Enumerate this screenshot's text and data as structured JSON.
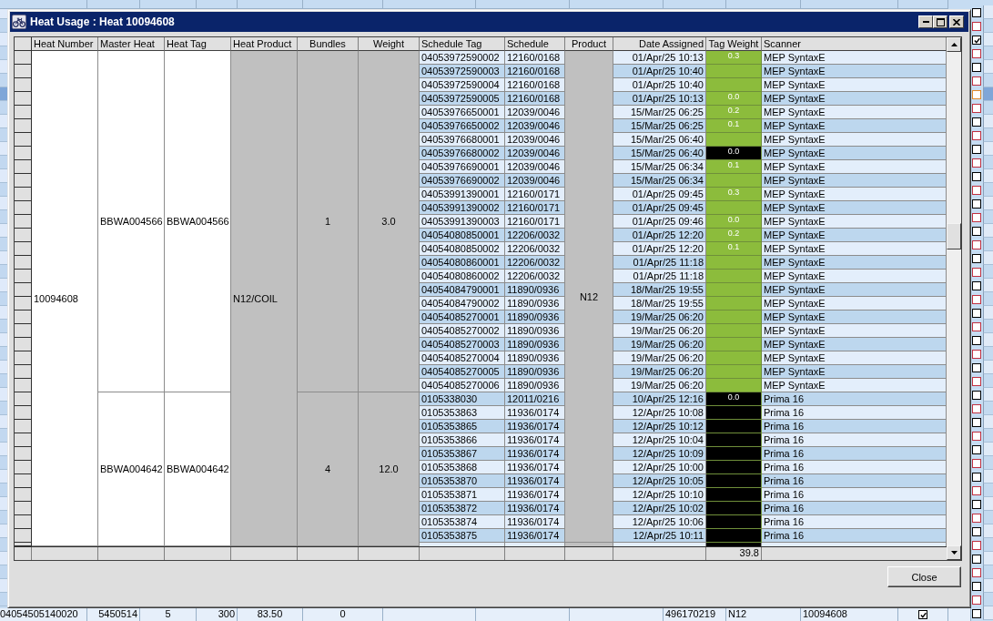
{
  "window": {
    "title": "Heat Usage : Heat 10094608"
  },
  "table": {
    "columns": [
      "Heat Number",
      "Master Heat",
      "Heat Tag",
      "Heat Product",
      "Bundles",
      "Weight",
      "Schedule Tag",
      "Schedule",
      "Product",
      "Date Assigned",
      "Tag Weight",
      "Scanner"
    ],
    "heat_number": "10094608",
    "heat_product": "N12/COIL",
    "product": "N12",
    "groups": [
      {
        "master_heat": "BBWA004566",
        "heat_tag": "BBWA004566",
        "bundles": "1",
        "weight": "3.0",
        "rows": [
          {
            "schedule_tag": "04053972590002",
            "schedule": "12160/0168",
            "date_assigned": "01/Apr/25 10:13",
            "tag_weight": "0.3",
            "color": "#8cbc3c",
            "scanner": "MEP SyntaxE"
          },
          {
            "schedule_tag": "04053972590003",
            "schedule": "12160/0168",
            "date_assigned": "01/Apr/25 10:40",
            "color": "#8cbc3c",
            "scanner": "MEP SyntaxE"
          },
          {
            "schedule_tag": "04053972590004",
            "schedule": "12160/0168",
            "date_assigned": "01/Apr/25 10:40",
            "color": "#8cbc3c",
            "scanner": "MEP SyntaxE"
          },
          {
            "schedule_tag": "04053972590005",
            "schedule": "12160/0168",
            "date_assigned": "01/Apr/25 10:13",
            "tag_weight": "0.0",
            "color": "#8cbc3c",
            "scanner": "MEP SyntaxE"
          },
          {
            "schedule_tag": "04053976650001",
            "schedule": "12039/0046",
            "date_assigned": "15/Mar/25 06:25",
            "tag_weight": "0.2",
            "color": "#8cbc3c",
            "scanner": "MEP SyntaxE"
          },
          {
            "schedule_tag": "04053976650002",
            "schedule": "12039/0046",
            "date_assigned": "15/Mar/25 06:25",
            "tag_weight": "0.1",
            "color": "#8cbc3c",
            "scanner": "MEP SyntaxE"
          },
          {
            "schedule_tag": "04053976680001",
            "schedule": "12039/0046",
            "date_assigned": "15/Mar/25 06:40",
            "color": "#8cbc3c",
            "scanner": "MEP SyntaxE"
          },
          {
            "schedule_tag": "04053976680002",
            "schedule": "12039/0046",
            "date_assigned": "15/Mar/25 06:40",
            "tag_weight": "0.0",
            "color": "#000000",
            "scanner": "MEP SyntaxE"
          },
          {
            "schedule_tag": "04053976690001",
            "schedule": "12039/0046",
            "date_assigned": "15/Mar/25 06:34",
            "tag_weight": "0.1",
            "color": "#8cbc3c",
            "scanner": "MEP SyntaxE"
          },
          {
            "schedule_tag": "04053976690002",
            "schedule": "12039/0046",
            "date_assigned": "15/Mar/25 06:34",
            "color": "#8cbc3c",
            "scanner": "MEP SyntaxE"
          },
          {
            "schedule_tag": "04053991390001",
            "schedule": "12160/0171",
            "date_assigned": "01/Apr/25 09:45",
            "tag_weight": "0.3",
            "color": "#8cbc3c",
            "scanner": "MEP SyntaxE"
          },
          {
            "schedule_tag": "04053991390002",
            "schedule": "12160/0171",
            "date_assigned": "01/Apr/25 09:45",
            "color": "#8cbc3c",
            "scanner": "MEP SyntaxE"
          },
          {
            "schedule_tag": "04053991390003",
            "schedule": "12160/0171",
            "date_assigned": "01/Apr/25 09:46",
            "tag_weight": "0.0",
            "color": "#8cbc3c",
            "scanner": "MEP SyntaxE"
          },
          {
            "schedule_tag": "04054080850001",
            "schedule": "12206/0032",
            "date_assigned": "01/Apr/25 12:20",
            "tag_weight": "0.2",
            "color": "#8cbc3c",
            "scanner": "MEP SyntaxE"
          },
          {
            "schedule_tag": "04054080850002",
            "schedule": "12206/0032",
            "date_assigned": "01/Apr/25 12:20",
            "tag_weight": "0.1",
            "color": "#8cbc3c",
            "scanner": "MEP SyntaxE"
          },
          {
            "schedule_tag": "04054080860001",
            "schedule": "12206/0032",
            "date_assigned": "01/Apr/25 11:18",
            "color": "#8cbc3c",
            "scanner": "MEP SyntaxE"
          },
          {
            "schedule_tag": "04054080860002",
            "schedule": "12206/0032",
            "date_assigned": "01/Apr/25 11:18",
            "color": "#8cbc3c",
            "scanner": "MEP SyntaxE"
          },
          {
            "schedule_tag": "04054084790001",
            "schedule": "11890/0936",
            "date_assigned": "18/Mar/25 19:55",
            "color": "#8cbc3c",
            "scanner": "MEP SyntaxE"
          },
          {
            "schedule_tag": "04054084790002",
            "schedule": "11890/0936",
            "date_assigned": "18/Mar/25 19:55",
            "color": "#8cbc3c",
            "scanner": "MEP SyntaxE"
          },
          {
            "schedule_tag": "04054085270001",
            "schedule": "11890/0936",
            "date_assigned": "19/Mar/25 06:20",
            "color": "#8cbc3c",
            "scanner": "MEP SyntaxE"
          },
          {
            "schedule_tag": "04054085270002",
            "schedule": "11890/0936",
            "date_assigned": "19/Mar/25 06:20",
            "color": "#8cbc3c",
            "scanner": "MEP SyntaxE"
          },
          {
            "schedule_tag": "04054085270003",
            "schedule": "11890/0936",
            "date_assigned": "19/Mar/25 06:20",
            "color": "#8cbc3c",
            "scanner": "MEP SyntaxE"
          },
          {
            "schedule_tag": "04054085270004",
            "schedule": "11890/0936",
            "date_assigned": "19/Mar/25 06:20",
            "color": "#8cbc3c",
            "scanner": "MEP SyntaxE"
          },
          {
            "schedule_tag": "04054085270005",
            "schedule": "11890/0936",
            "date_assigned": "19/Mar/25 06:20",
            "color": "#8cbc3c",
            "scanner": "MEP SyntaxE"
          },
          {
            "schedule_tag": "04054085270006",
            "schedule": "11890/0936",
            "date_assigned": "19/Mar/25 06:20",
            "color": "#8cbc3c",
            "scanner": "MEP SyntaxE"
          }
        ]
      },
      {
        "master_heat": "BBWA004642",
        "heat_tag": "BBWA004642",
        "bundles": "4",
        "weight": "12.0",
        "rows": [
          {
            "schedule_tag": "0105338030",
            "schedule": "12011/0216",
            "date_assigned": "10/Apr/25 12:16",
            "tag_weight": "0.0",
            "color": "#000000",
            "scanner": "Prima 16"
          },
          {
            "schedule_tag": "0105353863",
            "schedule": "11936/0174",
            "date_assigned": "12/Apr/25 10:08",
            "color": "#000000",
            "scanner": "Prima 16"
          },
          {
            "schedule_tag": "0105353865",
            "schedule": "11936/0174",
            "date_assigned": "12/Apr/25 10:12",
            "color": "#000000",
            "scanner": "Prima 16"
          },
          {
            "schedule_tag": "0105353866",
            "schedule": "11936/0174",
            "date_assigned": "12/Apr/25 10:04",
            "color": "#000000",
            "scanner": "Prima 16"
          },
          {
            "schedule_tag": "0105353867",
            "schedule": "11936/0174",
            "date_assigned": "12/Apr/25 10:09",
            "color": "#000000",
            "scanner": "Prima 16"
          },
          {
            "schedule_tag": "0105353868",
            "schedule": "11936/0174",
            "date_assigned": "12/Apr/25 10:00",
            "color": "#000000",
            "scanner": "Prima 16"
          },
          {
            "schedule_tag": "0105353870",
            "schedule": "11936/0174",
            "date_assigned": "12/Apr/25 10:05",
            "color": "#000000",
            "scanner": "Prima 16"
          },
          {
            "schedule_tag": "0105353871",
            "schedule": "11936/0174",
            "date_assigned": "12/Apr/25 10:10",
            "color": "#000000",
            "scanner": "Prima 16"
          },
          {
            "schedule_tag": "0105353872",
            "schedule": "11936/0174",
            "date_assigned": "12/Apr/25 10:02",
            "color": "#000000",
            "scanner": "Prima 16"
          },
          {
            "schedule_tag": "0105353874",
            "schedule": "11936/0174",
            "date_assigned": "12/Apr/25 10:06",
            "color": "#000000",
            "scanner": "Prima 16"
          },
          {
            "schedule_tag": "0105353875",
            "schedule": "11936/0174",
            "date_assigned": "12/Apr/25 10:11",
            "color": "#000000",
            "scanner": "Prima 16"
          }
        ]
      }
    ],
    "footer": {
      "tag_weight_total": "39.8"
    }
  },
  "buttons": [
    "Close"
  ],
  "background": {
    "rows": [
      {
        "checked": false,
        "selected": false,
        "color": "#000000"
      },
      {
        "checked": false,
        "selected": false,
        "color": "#c03040"
      },
      {
        "checked": true,
        "selected": false,
        "color": "#000000"
      },
      {
        "checked": false,
        "selected": false,
        "color": "#c03040"
      },
      {
        "checked": false,
        "selected": false,
        "color": "#000000"
      },
      {
        "checked": false,
        "selected": false,
        "color": "#c03040"
      },
      {
        "checked": false,
        "selected": true,
        "color": "#e08a2c"
      },
      {
        "checked": false,
        "selected": false,
        "color": "#c03040"
      },
      {
        "checked": false,
        "selected": false,
        "color": "#000000"
      },
      {
        "checked": false,
        "selected": false,
        "color": "#c03040"
      },
      {
        "checked": false,
        "selected": false,
        "color": "#000000"
      },
      {
        "checked": false,
        "selected": false,
        "color": "#c03040"
      },
      {
        "checked": false,
        "selected": false,
        "color": "#000000"
      },
      {
        "checked": false,
        "selected": false,
        "color": "#c03040"
      },
      {
        "checked": false,
        "selected": false,
        "color": "#000000"
      },
      {
        "checked": false,
        "selected": false,
        "color": "#c03040"
      },
      {
        "checked": false,
        "selected": false,
        "color": "#000000"
      },
      {
        "checked": false,
        "selected": false,
        "color": "#c03040"
      },
      {
        "checked": false,
        "selected": false,
        "color": "#000000"
      },
      {
        "checked": false,
        "selected": false,
        "color": "#c03040"
      },
      {
        "checked": false,
        "selected": false,
        "color": "#000000"
      },
      {
        "checked": false,
        "selected": false,
        "color": "#c03040"
      },
      {
        "checked": false,
        "selected": false,
        "color": "#000000"
      },
      {
        "checked": false,
        "selected": false,
        "color": "#c03040"
      },
      {
        "checked": false,
        "selected": false,
        "color": "#000000"
      },
      {
        "checked": false,
        "selected": false,
        "color": "#c03040"
      },
      {
        "checked": false,
        "selected": false,
        "color": "#000000"
      },
      {
        "checked": false,
        "selected": false,
        "color": "#c03040"
      },
      {
        "checked": false,
        "selected": false,
        "color": "#000000"
      },
      {
        "checked": false,
        "selected": false,
        "color": "#c03040"
      },
      {
        "checked": false,
        "selected": false,
        "color": "#000000"
      },
      {
        "checked": false,
        "selected": false,
        "color": "#c03040"
      },
      {
        "checked": false,
        "selected": false,
        "color": "#000000"
      },
      {
        "checked": false,
        "selected": false,
        "color": "#c03040"
      },
      {
        "checked": false,
        "selected": false,
        "color": "#000000"
      },
      {
        "checked": false,
        "selected": false,
        "color": "#c03040"
      },
      {
        "checked": false,
        "selected": false,
        "color": "#000000"
      },
      {
        "checked": false,
        "selected": false,
        "color": "#c03040"
      },
      {
        "checked": false,
        "selected": false,
        "color": "#000000"
      },
      {
        "checked": false,
        "selected": false,
        "color": "#c03040"
      },
      {
        "checked": false,
        "selected": false,
        "color": "#000000"
      },
      {
        "checked": false,
        "selected": false,
        "color": "#c03040"
      },
      {
        "checked": false,
        "selected": false,
        "color": "#000000"
      },
      {
        "checked": false,
        "selected": false,
        "color": "#c03040"
      },
      {
        "checked": false,
        "selected": false,
        "color": "#000000"
      }
    ],
    "bottom_row": {
      "column_1": "04054505140020",
      "column_2": "5450514",
      "column_3": "5",
      "column_4": "300",
      "column_5": "83.50",
      "column_6": "0",
      "column_10": "496170219",
      "column_11": "N12",
      "column_12": "10094608",
      "column_13": {
        "checked": true
      }
    }
  }
}
